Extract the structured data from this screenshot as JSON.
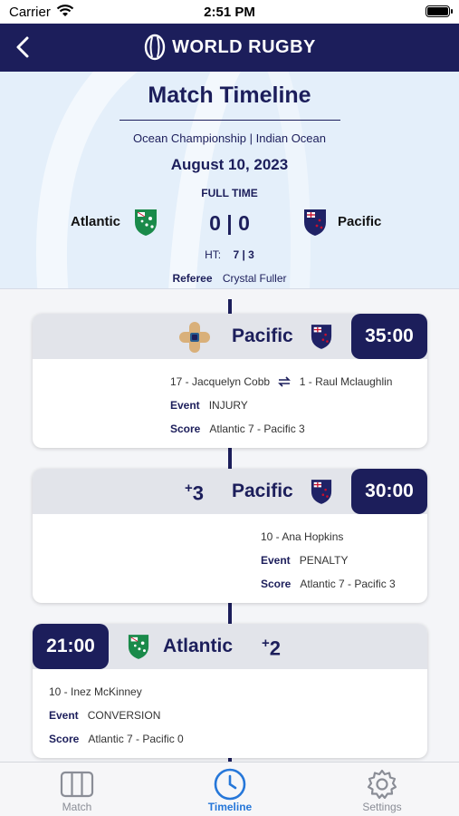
{
  "status_bar": {
    "carrier": "Carrier",
    "time": "2:51 PM"
  },
  "nav": {
    "brand": "WORLD RUGBY",
    "back_icon": "chevron-left-icon"
  },
  "match": {
    "title": "Match Timeline",
    "competition": "Ocean Championship",
    "venue": "Indian Ocean",
    "date": "August 10, 2023",
    "status": "FULL TIME",
    "home_team": "Atlantic",
    "away_team": "Pacific",
    "score": "0 | 0",
    "ht_label": "HT:",
    "ht_score": "7 | 3",
    "referee_label": "Referee",
    "referee": "Crystal Fuller"
  },
  "events": [
    {
      "clock": "35:00",
      "team": "Pacific",
      "icon": "bandage-icon",
      "players": "17 - Jacquelyn Cobb",
      "swap_icon": "substitution-arrows-icon",
      "players_in": "1 - Raul Mclaughlin",
      "event_label": "Event",
      "event": "INJURY",
      "score_label": "Score",
      "score": "Atlantic 7 - Pacific 3"
    },
    {
      "clock": "30:00",
      "team": "Pacific",
      "points_sign": "+",
      "points": "3",
      "players": "10 - Ana Hopkins",
      "event_label": "Event",
      "event": "PENALTY",
      "score_label": "Score",
      "score": "Atlantic 7 - Pacific 3"
    },
    {
      "clock": "21:00",
      "team": "Atlantic",
      "points_sign": "+",
      "points": "2",
      "players": "10 - Inez McKinney",
      "event_label": "Event",
      "event": "CONVERSION",
      "score_label": "Score",
      "score": "Atlantic 7 - Pacific 0"
    }
  ],
  "tabs": [
    {
      "label": "Match",
      "icon": "pitch-icon",
      "active": false
    },
    {
      "label": "Timeline",
      "icon": "clock-icon",
      "active": true
    },
    {
      "label": "Settings",
      "icon": "gear-icon",
      "active": false
    }
  ],
  "colors": {
    "navy": "#1c1e5b",
    "header_bg": "#e4effa",
    "active_tab": "#2677d9",
    "atlantic_green": "#1a8a4a",
    "pacific_navy": "#1f2266"
  }
}
